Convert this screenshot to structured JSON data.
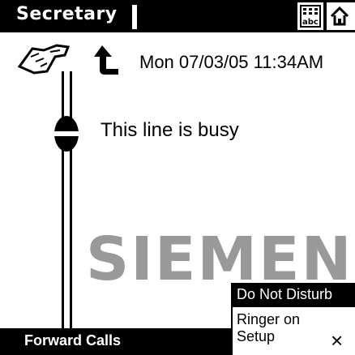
{
  "header": {
    "title": "Secretary",
    "buttons": [
      {
        "name": "keypad-button",
        "icon": "abc-keypad-icon"
      },
      {
        "name": "home-button",
        "icon": "home-icon"
      },
      {
        "name": "help-button",
        "icon": "help-icon",
        "label": "?"
      }
    ]
  },
  "status": {
    "datetime": "Mon 07/03/05 11:34AM",
    "line_message": "This line is busy"
  },
  "watermark": "SIEMENS",
  "menu": {
    "items": [
      {
        "label": "Do Not Disturb",
        "selected": true
      },
      {
        "label": "Ringer on",
        "selected": false
      },
      {
        "label": "Setup",
        "selected": false
      }
    ]
  },
  "footer": {
    "forward_label": "Forward Calls",
    "close_label": "×"
  },
  "colors": {
    "background": "#ffffff",
    "foreground": "#000000",
    "watermark": "#999999"
  }
}
